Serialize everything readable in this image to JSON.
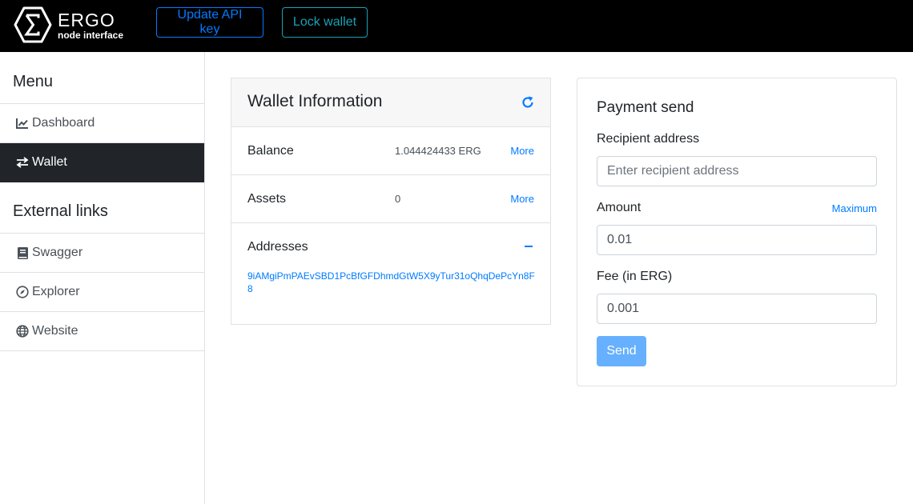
{
  "header": {
    "brand": "ERGO",
    "subtitle": "node interface",
    "update_api_key_label": "Update API key",
    "lock_wallet_label": "Lock wallet",
    "logo_icon": "ergo-sigma-hexagon-icon"
  },
  "sidebar": {
    "menu_heading": "Menu",
    "menu_items": [
      {
        "label": "Dashboard",
        "icon": "chart-line-icon",
        "active": false
      },
      {
        "label": "Wallet",
        "icon": "exchange-arrows-icon",
        "active": true
      }
    ],
    "external_heading": "External links",
    "external_items": [
      {
        "label": "Swagger",
        "icon": "book-icon"
      },
      {
        "label": "Explorer",
        "icon": "compass-icon"
      },
      {
        "label": "Website",
        "icon": "globe-icon"
      }
    ]
  },
  "wallet": {
    "title": "Wallet Information",
    "balance_label": "Balance",
    "balance_value": "1.044424433 ERG",
    "assets_label": "Assets",
    "assets_value": "0",
    "more_label": "More",
    "addresses_label": "Addresses",
    "address": "9iAMgiPmPAEvSBD1PcBfGFDhmdGtW5X9yTur31oQhqDePcYn8F8"
  },
  "payment": {
    "title": "Payment send",
    "recipient_label": "Recipient address",
    "recipient_placeholder": "Enter recipient address",
    "amount_label": "Amount",
    "maximum_label": "Maximum",
    "amount_value": "0.01",
    "fee_label": "Fee (in ERG)",
    "fee_value": "0.001",
    "send_label": "Send"
  },
  "colors": {
    "header_bg": "#000000",
    "primary": "#007bff",
    "info": "#17a2b8",
    "active_item_bg": "#212529",
    "send_disabled": "#66b0ff"
  }
}
